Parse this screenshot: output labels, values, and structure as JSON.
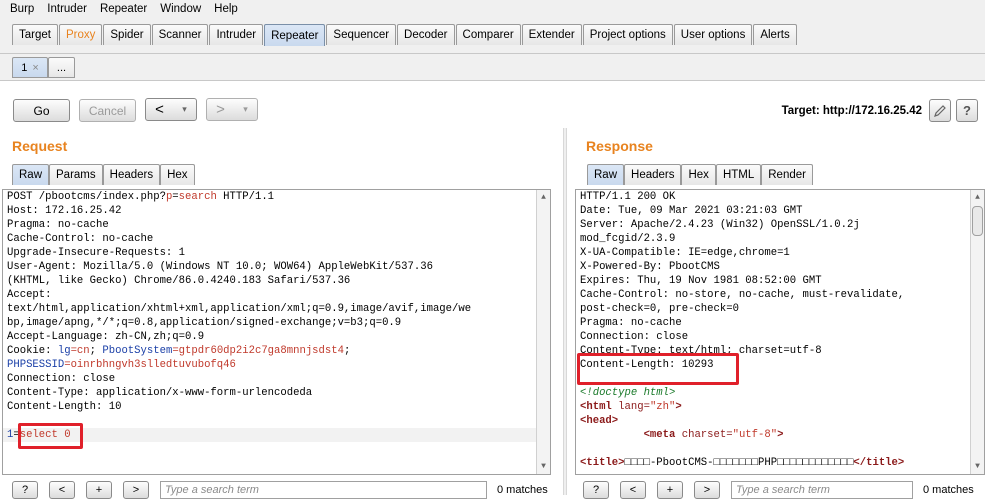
{
  "menu": [
    "Burp",
    "Intruder",
    "Repeater",
    "Window",
    "Help"
  ],
  "tabs": [
    "Target",
    "Proxy",
    "Spider",
    "Scanner",
    "Intruder",
    "Repeater",
    "Sequencer",
    "Decoder",
    "Comparer",
    "Extender",
    "Project options",
    "User options",
    "Alerts"
  ],
  "active_tab": "Repeater",
  "subtabs": {
    "first": "1",
    "close": "×",
    "new": "..."
  },
  "controls": {
    "go": "Go",
    "cancel": "Cancel",
    "back": "<",
    "forward": ">",
    "dropdown": "▾",
    "target_label": "Target: http://172.16.25.42",
    "edit_icon": "pencil-icon",
    "help_icon": "question-icon"
  },
  "request": {
    "title": "Request",
    "tabs": [
      "Raw",
      "Params",
      "Headers",
      "Hex"
    ],
    "lines": [
      "POST /pbootcms/index.php?p=search HTTP/1.1",
      "Host: 172.16.25.42",
      "Pragma: no-cache",
      "Cache-Control: no-cache",
      "Upgrade-Insecure-Requests: 1",
      "User-Agent: Mozilla/5.0 (Windows NT 10.0; WOW64) AppleWebKit/537.36",
      "(KHTML, like Gecko) Chrome/86.0.4240.183 Safari/537.36",
      "Accept:",
      "text/html,application/xhtml+xml,application/xml;q=0.9,image/avif,image/we",
      "bp,image/apng,*/*;q=0.8,application/signed-exchange;v=b3;q=0.9",
      "Accept-Language: zh-CN,zh;q=0.9",
      "Cookie: lg=cn; PbootSystem=gtpdr60dp2i2c7ga8mnnjsdst4;",
      "PHPSESSID=oinrbhngvh3slledtuvubofq46",
      "Connection: close",
      "Content-Type: application/x-www-form-urlencodeda",
      "Content-Length: 10",
      "",
      "1=select 0"
    ]
  },
  "response": {
    "title": "Response",
    "tabs": [
      "Raw",
      "Headers",
      "Hex",
      "HTML",
      "Render"
    ],
    "lines": [
      "HTTP/1.1 200 OK",
      "Date: Tue, 09 Mar 2021 03:21:03 GMT",
      "Server: Apache/2.4.23 (Win32) OpenSSL/1.0.2j",
      "mod_fcgid/2.3.9",
      "X-UA-Compatible: IE=edge,chrome=1",
      "X-Powered-By: PbootCMS",
      "Expires: Thu, 19 Nov 1981 08:52:00 GMT",
      "Cache-Control: no-store, no-cache, must-revalidate,",
      "post-check=0, pre-check=0",
      "Pragma: no-cache",
      "Connection: close",
      "Content-Type: text/html; charset=utf-8",
      "Content-Length: 10293",
      "",
      "<!doctype html>",
      "<html lang=\"zh\">",
      "<head>",
      "          <meta charset=\"utf-8\">",
      "",
      "<title>□□□□-PbootCMS-□□□□□□□PHP□□□□□□□□□□□□</title>"
    ]
  },
  "search": {
    "placeholder": "Type a search term",
    "matches": "0 matches",
    "help": "?",
    "prev": "<",
    "add": "+",
    "next": ">"
  },
  "colors": {
    "accent": "#e8831f",
    "highlight_box": "#e0202a",
    "tab_active": "#c9d9ee"
  }
}
